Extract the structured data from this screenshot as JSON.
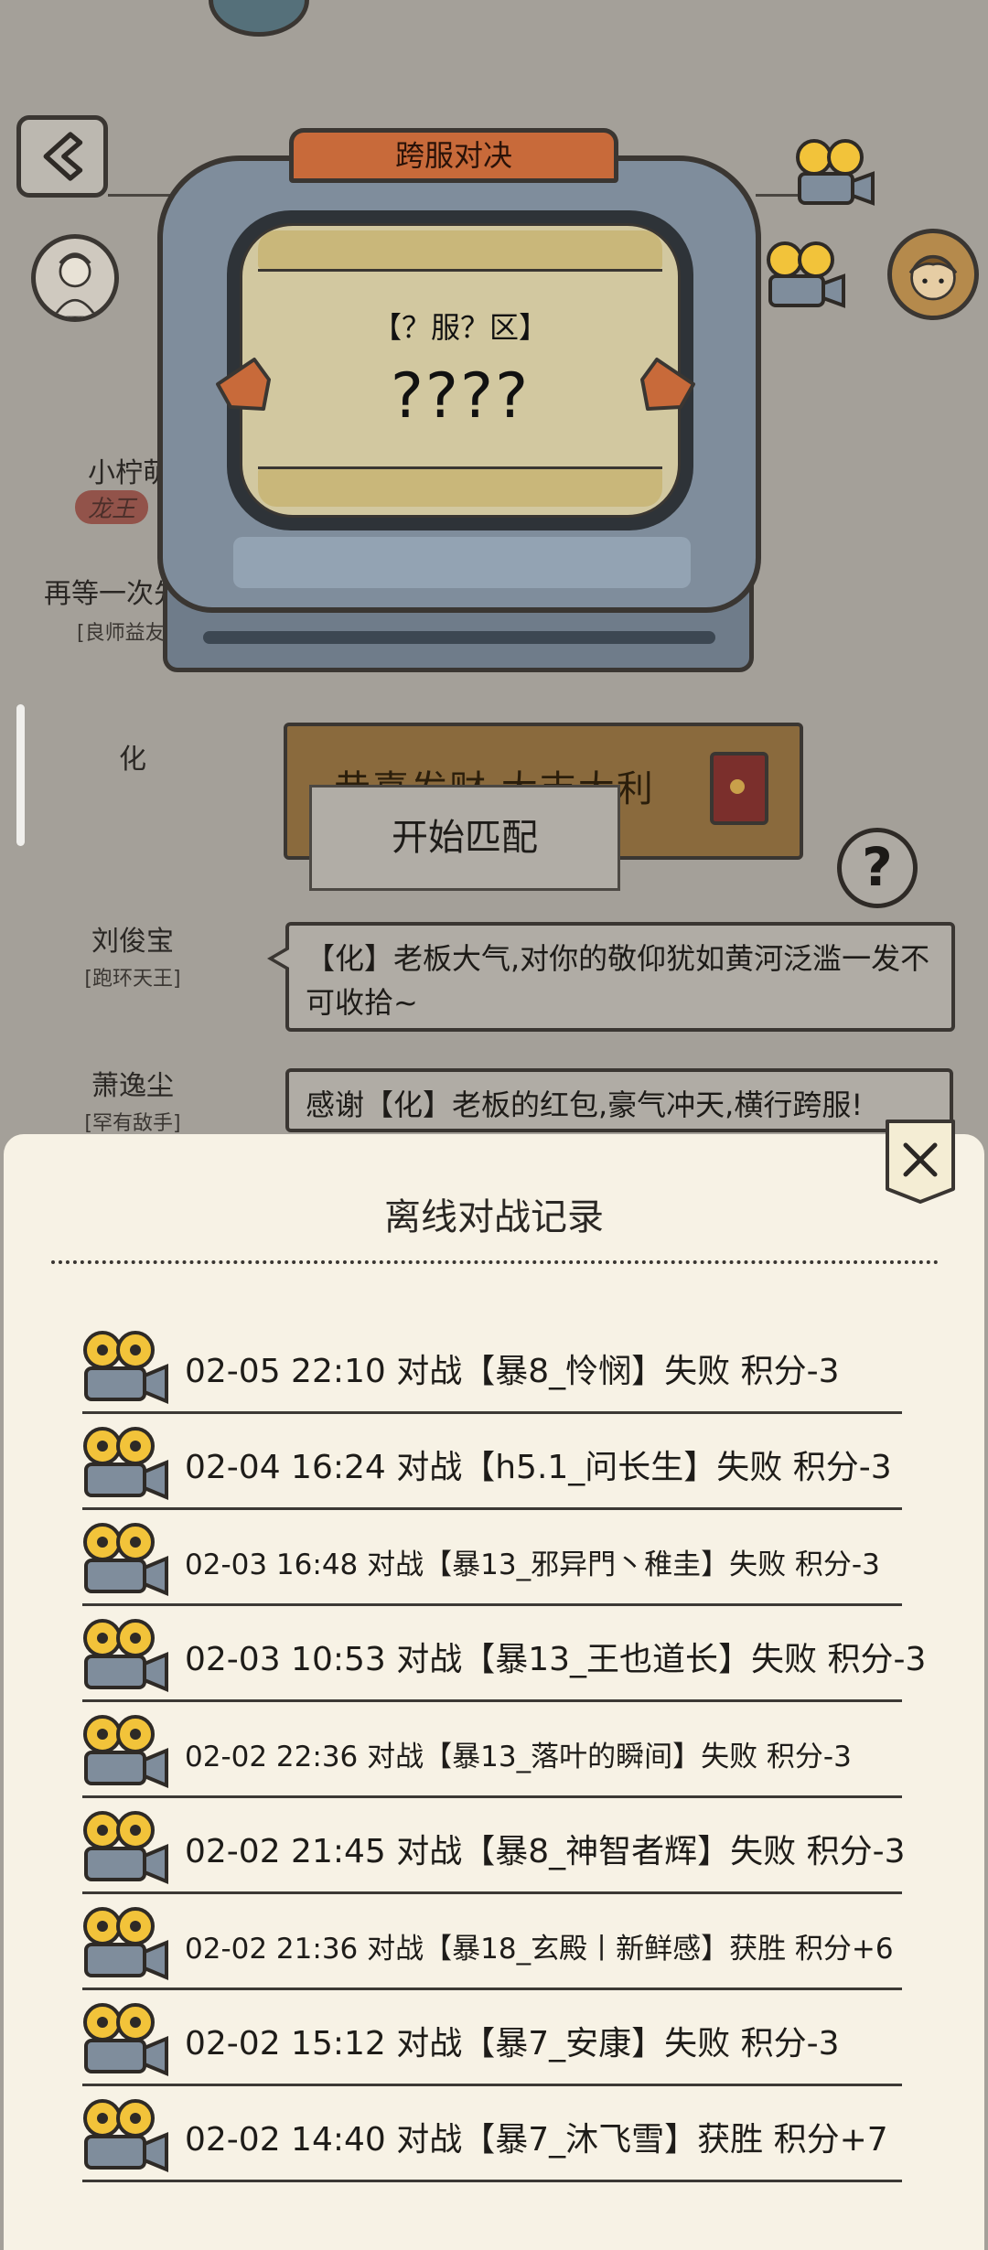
{
  "header": {
    "back_icon": "chevron-left-icon"
  },
  "players": [
    {
      "name": "小柠萌",
      "seal": "龙王"
    },
    {
      "name": "再等一次先",
      "title": "[良师益友]"
    },
    {
      "name": "化"
    },
    {
      "name": "刘俊宝",
      "title": "[跑环天王]"
    },
    {
      "name": "萧逸尘",
      "title": "[罕有敌手]"
    }
  ],
  "machine": {
    "tab_label": "跨服对决",
    "server_label": "【？服？区】",
    "opponent_label": "????"
  },
  "chat": {
    "gift_text": "恭喜发财 大吉大利",
    "messages": [
      "【化】老板大气,对你的敬仰犹如黄河泛滥一发不可收拾~",
      "感谢【化】老板的红包,豪气冲天,横行跨服!"
    ]
  },
  "actions": {
    "match_label": "开始匹配",
    "help_label": "?"
  },
  "modal": {
    "title": "离线对战记录",
    "close_label": "×",
    "records": [
      "02-05 22:10 对战【暴8_怜悯】失败 积分-3",
      "02-04 16:24 对战【h5.1_问长生】失败 积分-3",
      "02-03 16:48 对战【暴13_邪异門丶稚圭】失败 积分-3",
      "02-03 10:53 对战【暴13_王也道长】失败 积分-3",
      "02-02 22:36 对战【暴13_落叶的瞬间】失败 积分-3",
      "02-02 21:45 对战【暴8_神智者辉】失败 积分-3",
      "02-02 21:36 对战【暴18_玄殿丨新鲜感】获胜 积分+6",
      "02-02 15:12 对战【暴7_安康】失败 积分-3",
      "02-02 14:40 对战【暴7_沐飞雪】获胜 积分+7"
    ]
  },
  "colors": {
    "modal_bg": "#f7f2e5",
    "dim_bg": "#a4a099",
    "machine_blue": "#7f8d9c",
    "tab_orange": "#c86a3a",
    "reel_yellow": "#f2c33a"
  }
}
